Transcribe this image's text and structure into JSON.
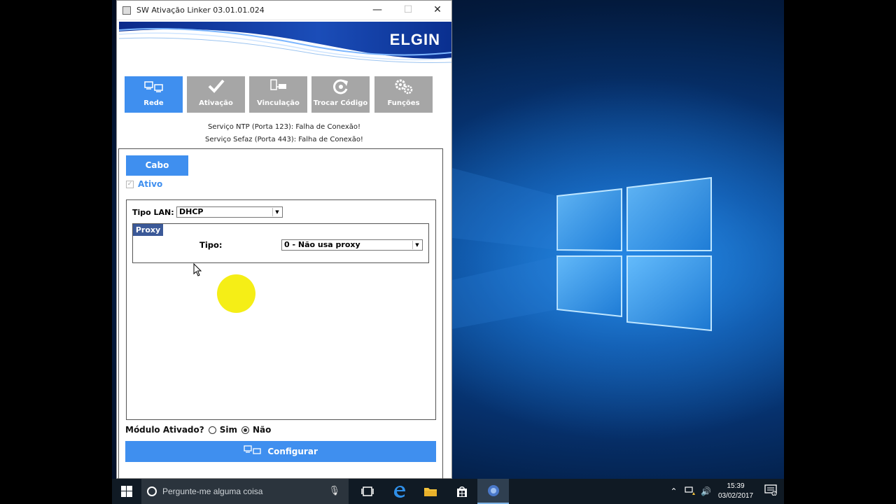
{
  "window": {
    "title": "SW Ativação Linker 03.01.01.024",
    "minimize_glyph": "—",
    "maximize_glyph": "☐",
    "close_glyph": "✕",
    "brand": "ELGIN"
  },
  "nav": [
    {
      "label": "Rede",
      "icon": "network-icon",
      "active": true
    },
    {
      "label": "Ativação",
      "icon": "check-icon",
      "active": false
    },
    {
      "label": "Vinculação",
      "icon": "link-devices-icon",
      "active": false
    },
    {
      "label": "Trocar Código",
      "icon": "refresh-icon",
      "active": false
    },
    {
      "label": "Funções",
      "icon": "gears-icon",
      "active": false
    }
  ],
  "status": {
    "ntp": "Serviço NTP (Porta 123): Falha de Conexão!",
    "sefaz": "Serviço Sefaz (Porta 443): Falha de Conexão!"
  },
  "panel": {
    "tab_label": "Cabo",
    "ativo_label": "Ativo",
    "ativo_checked": true,
    "tipo_lan_label": "Tipo LAN:",
    "tipo_lan_value": "DHCP",
    "proxy_title": "Proxy",
    "proxy_tipo_label": "Tipo:",
    "proxy_tipo_value": "0 - Não usa proxy"
  },
  "modulo": {
    "label": "Módulo Ativado?",
    "sim": "Sim",
    "nao": "Não",
    "selected": "Não"
  },
  "configurar_label": "Configurar",
  "taskbar": {
    "search_placeholder": "Pergunte-me alguma coisa",
    "time": "15:39",
    "date": "03/02/2017",
    "notification_count": "1"
  },
  "colors": {
    "accent": "#3f8fef",
    "nav_inactive": "#a6a6a6",
    "proxy_header": "#3b5998",
    "highlight": "#f5ee16"
  }
}
